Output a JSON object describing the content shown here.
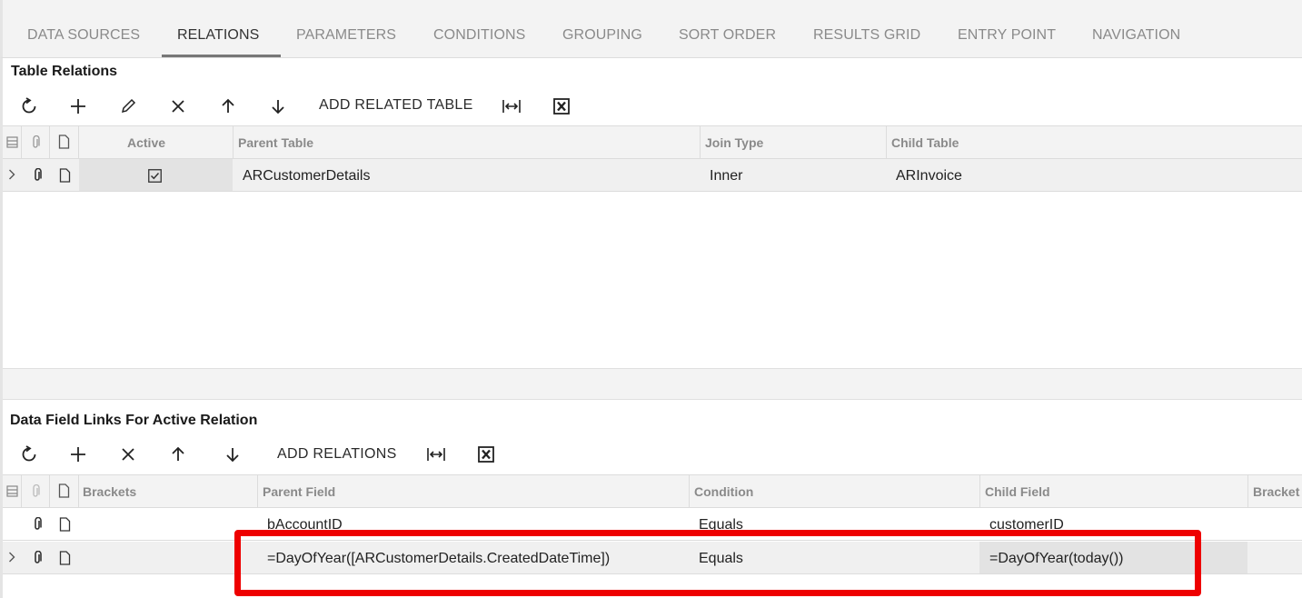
{
  "tabs": [
    {
      "label": "DATA SOURCES",
      "active": false
    },
    {
      "label": "RELATIONS",
      "active": true
    },
    {
      "label": "PARAMETERS",
      "active": false
    },
    {
      "label": "CONDITIONS",
      "active": false
    },
    {
      "label": "GROUPING",
      "active": false
    },
    {
      "label": "SORT ORDER",
      "active": false
    },
    {
      "label": "RESULTS GRID",
      "active": false
    },
    {
      "label": "ENTRY POINT",
      "active": false
    },
    {
      "label": "NAVIGATION",
      "active": false
    }
  ],
  "table_relations": {
    "title": "Table Relations",
    "add_label": "ADD RELATED TABLE",
    "columns": [
      "Active",
      "Parent Table",
      "Join Type",
      "Child Table"
    ],
    "rows": [
      {
        "active": true,
        "parent_table": "ARCustomerDetails",
        "join_type": "Inner",
        "child_table": "ARInvoice"
      }
    ]
  },
  "field_links": {
    "title": "Data Field Links For Active Relation",
    "add_label": "ADD RELATIONS",
    "columns": [
      "Brackets",
      "Parent Field",
      "Condition",
      "Child Field",
      "Bracket"
    ],
    "rows": [
      {
        "brackets": "",
        "parent_field": "bAccountID",
        "condition": "Equals",
        "child_field": "customerID"
      },
      {
        "brackets": "",
        "parent_field": "=DayOfYear([ARCustomerDetails.CreatedDateTime])",
        "condition": "Equals",
        "child_field": "=DayOfYear(today())"
      }
    ]
  },
  "colors": {
    "highlight": "#ee0000",
    "header_bg": "#f3f3f3",
    "active_tab_underline": "#777777"
  }
}
